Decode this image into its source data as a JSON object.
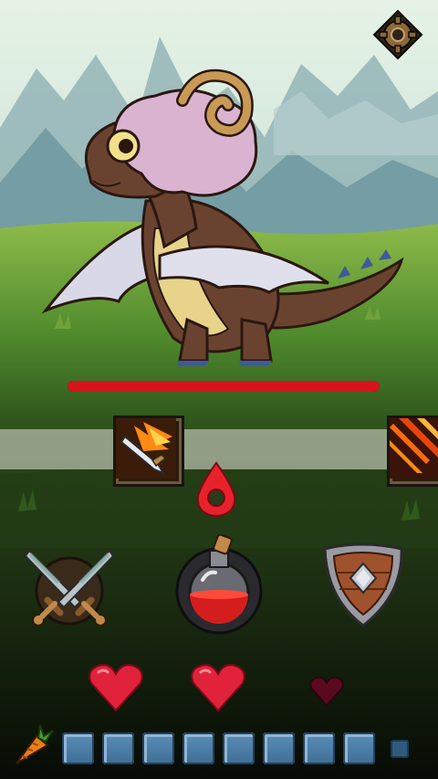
{
  "game": {
    "enemy": {
      "name": "",
      "health_fraction": 1.0
    },
    "skills": [
      {
        "icon": "flaming-sword-icon"
      },
      {
        "icon": "fire-streaks-icon"
      }
    ],
    "actions": {
      "attack": {
        "icon": "crossed-swords-icon"
      },
      "potion": {
        "icon": "health-potion-icon",
        "fill_fraction": 0.5
      },
      "defend": {
        "icon": "wooden-shield-icon"
      }
    },
    "lives": {
      "full": 2,
      "total": 3
    },
    "inventory": {
      "item_icon": "carrot-icon",
      "slots": 8
    },
    "colors": {
      "health": "#d8141b",
      "heart": "#e0223a",
      "heart_empty": "#5a0a1e",
      "slot": "#4a7ea8",
      "marker": "#e8222c"
    }
  }
}
